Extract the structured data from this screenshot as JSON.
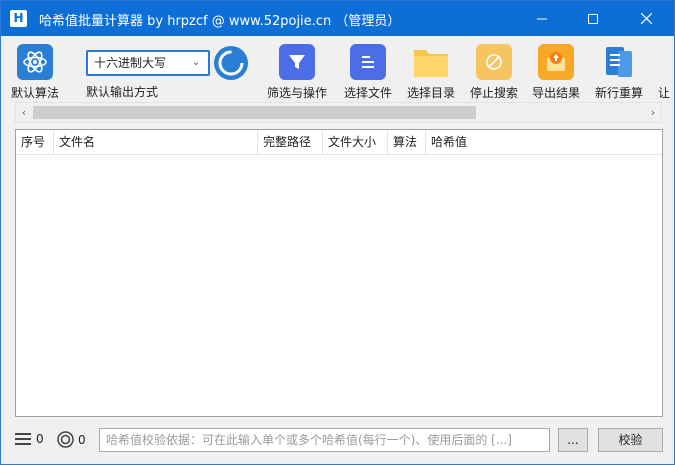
{
  "window": {
    "app_icon": "H",
    "title": "哈希值批量计算器 by hrpzcf @ www.52pojie.cn （管理员）",
    "controls": [
      "minimize-icon",
      "maximize-icon",
      "close-icon"
    ]
  },
  "toolbar": {
    "default_algorithm": "默认算法",
    "output_format_value": "十六进制大写",
    "output_format_label": "默认输出方式",
    "filter": "筛选与操作",
    "select_files": "选择文件",
    "select_dir": "选择目录",
    "stop_search": "停止搜索",
    "export": "导出结果",
    "recalc": "新行重算",
    "overflow": "让"
  },
  "grid": {
    "columns": [
      "序号",
      "文件名",
      "完整路径",
      "文件大小",
      "算法",
      "哈希值"
    ],
    "rows": []
  },
  "status": {
    "list_count": "0",
    "target_count": "0",
    "verify_placeholder": "哈希值校验依据：可在此输入单个或多个哈希值(每行一个)、使用后面的 [...]",
    "browse_button": "...",
    "verify_button": "校验"
  },
  "colors": {
    "titlebar": "#0d6fd6",
    "accent": "#2b78d6"
  }
}
